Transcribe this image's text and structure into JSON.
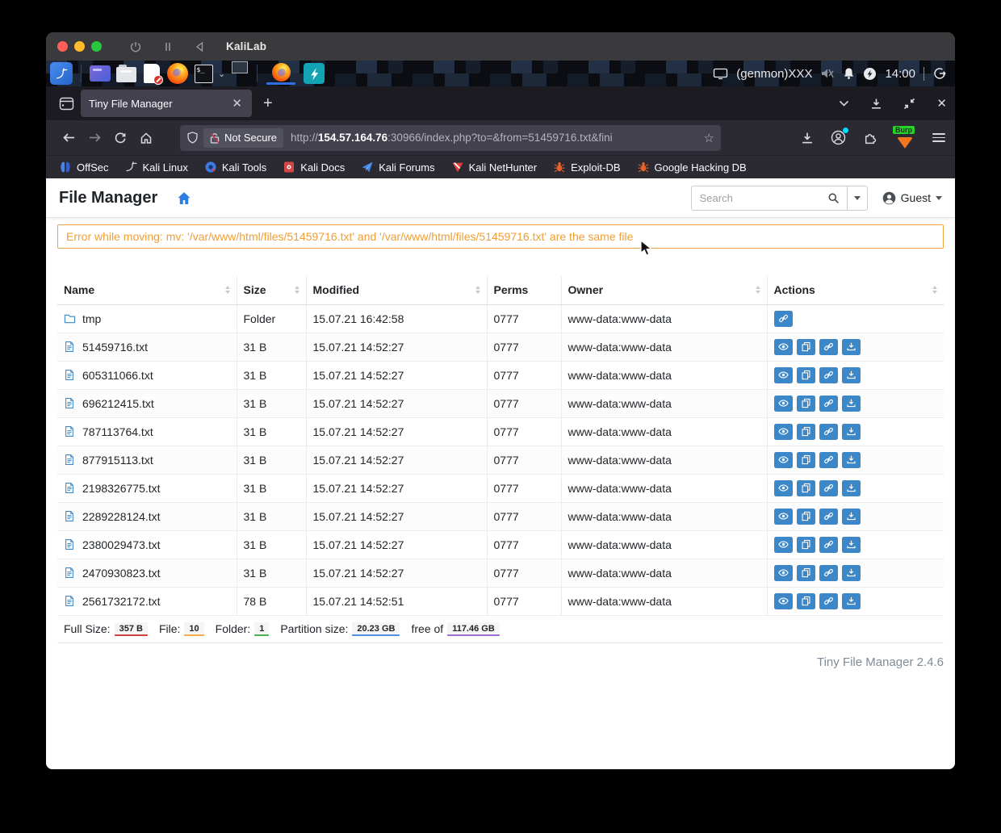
{
  "macos": {
    "window_title": "KaliLab"
  },
  "taskbar": {
    "genmon_label": "(genmon)XXX",
    "clock": "14:00",
    "terminal_prompt": "$_"
  },
  "browser": {
    "tab": {
      "title": "Tiny File Manager"
    },
    "address": {
      "security_label": "Not Secure",
      "url_scheme": "http://",
      "url_host": "154.57.164.76",
      "url_path": ":30966/index.php?to=&from=51459716.txt&fini"
    },
    "proxy_extension_label": "Burp",
    "bookmarks": [
      {
        "label": "OffSec",
        "icon": "offsec-icon"
      },
      {
        "label": "Kali Linux",
        "icon": "kali-dragon-icon"
      },
      {
        "label": "Kali Tools",
        "icon": "kali-tools-icon"
      },
      {
        "label": "Kali Docs",
        "icon": "kali-docs-icon"
      },
      {
        "label": "Kali Forums",
        "icon": "kali-forums-icon"
      },
      {
        "label": "Kali NetHunter",
        "icon": "kali-nethunter-icon"
      },
      {
        "label": "Exploit-DB",
        "icon": "exploitdb-bug-icon"
      },
      {
        "label": "Google Hacking DB",
        "icon": "ghdb-bug-icon"
      }
    ]
  },
  "filemanager": {
    "title": "File Manager",
    "search_placeholder": "Search",
    "user": "Guest",
    "alert": "Error while moving: mv: '/var/www/html/files/51459716.txt' and '/var/www/html/files/51459716.txt' are the same file",
    "colors": {
      "accent_blue": "#3c87c8",
      "alert_orange": "#efa143",
      "home_blue": "#2a7de1"
    },
    "table": {
      "columns": [
        {
          "label": "Name",
          "sortable": true
        },
        {
          "label": "Size",
          "sortable": true
        },
        {
          "label": "Modified",
          "sortable": true
        },
        {
          "label": "Perms",
          "sortable": false
        },
        {
          "label": "Owner",
          "sortable": true
        },
        {
          "label": "Actions",
          "sortable": true
        }
      ],
      "rows": [
        {
          "name": "tmp",
          "icon": "folder-icon",
          "size": "Folder",
          "modified": "15.07.21 16:42:58",
          "perms": "0777",
          "owner": "www-data:www-data",
          "actions": [
            "link"
          ]
        },
        {
          "name": "51459716.txt",
          "icon": "file-icon",
          "size": "31 B",
          "modified": "15.07.21 14:52:27",
          "perms": "0777",
          "owner": "www-data:www-data",
          "actions": [
            "preview",
            "copy",
            "link",
            "download"
          ]
        },
        {
          "name": "605311066.txt",
          "icon": "file-icon",
          "size": "31 B",
          "modified": "15.07.21 14:52:27",
          "perms": "0777",
          "owner": "www-data:www-data",
          "actions": [
            "preview",
            "copy",
            "link",
            "download"
          ]
        },
        {
          "name": "696212415.txt",
          "icon": "file-icon",
          "size": "31 B",
          "modified": "15.07.21 14:52:27",
          "perms": "0777",
          "owner": "www-data:www-data",
          "actions": [
            "preview",
            "copy",
            "link",
            "download"
          ]
        },
        {
          "name": "787113764.txt",
          "icon": "file-icon",
          "size": "31 B",
          "modified": "15.07.21 14:52:27",
          "perms": "0777",
          "owner": "www-data:www-data",
          "actions": [
            "preview",
            "copy",
            "link",
            "download"
          ]
        },
        {
          "name": "877915113.txt",
          "icon": "file-icon",
          "size": "31 B",
          "modified": "15.07.21 14:52:27",
          "perms": "0777",
          "owner": "www-data:www-data",
          "actions": [
            "preview",
            "copy",
            "link",
            "download"
          ]
        },
        {
          "name": "2198326775.txt",
          "icon": "file-icon",
          "size": "31 B",
          "modified": "15.07.21 14:52:27",
          "perms": "0777",
          "owner": "www-data:www-data",
          "actions": [
            "preview",
            "copy",
            "link",
            "download"
          ]
        },
        {
          "name": "2289228124.txt",
          "icon": "file-icon",
          "size": "31 B",
          "modified": "15.07.21 14:52:27",
          "perms": "0777",
          "owner": "www-data:www-data",
          "actions": [
            "preview",
            "copy",
            "link",
            "download"
          ]
        },
        {
          "name": "2380029473.txt",
          "icon": "file-icon",
          "size": "31 B",
          "modified": "15.07.21 14:52:27",
          "perms": "0777",
          "owner": "www-data:www-data",
          "actions": [
            "preview",
            "copy",
            "link",
            "download"
          ]
        },
        {
          "name": "2470930823.txt",
          "icon": "file-icon",
          "size": "31 B",
          "modified": "15.07.21 14:52:27",
          "perms": "0777",
          "owner": "www-data:www-data",
          "actions": [
            "preview",
            "copy",
            "link",
            "download"
          ]
        },
        {
          "name": "2561732172.txt",
          "icon": "file-icon",
          "size": "78 B",
          "modified": "15.07.21 14:52:51",
          "perms": "0777",
          "owner": "www-data:www-data",
          "actions": [
            "preview",
            "copy",
            "link",
            "download"
          ]
        }
      ]
    },
    "summary_items": [
      {
        "name": "full-size",
        "label": "Full Size:",
        "value": "357 B",
        "underline": "#d0433e"
      },
      {
        "name": "file-count",
        "label": "File:",
        "value": "10",
        "underline": "#f0ad4e"
      },
      {
        "name": "folder-count",
        "label": "Folder:",
        "value": "1",
        "underline": "#4cae4c"
      },
      {
        "name": "partition-size",
        "label": "Partition size:",
        "value": "20.23 GB",
        "underline": "#4f8fe0"
      },
      {
        "name": "free-space",
        "label": "free of",
        "value": "117.46 GB",
        "underline": "#9d6fd0"
      }
    ],
    "version": "Tiny File Manager 2.4.6"
  }
}
